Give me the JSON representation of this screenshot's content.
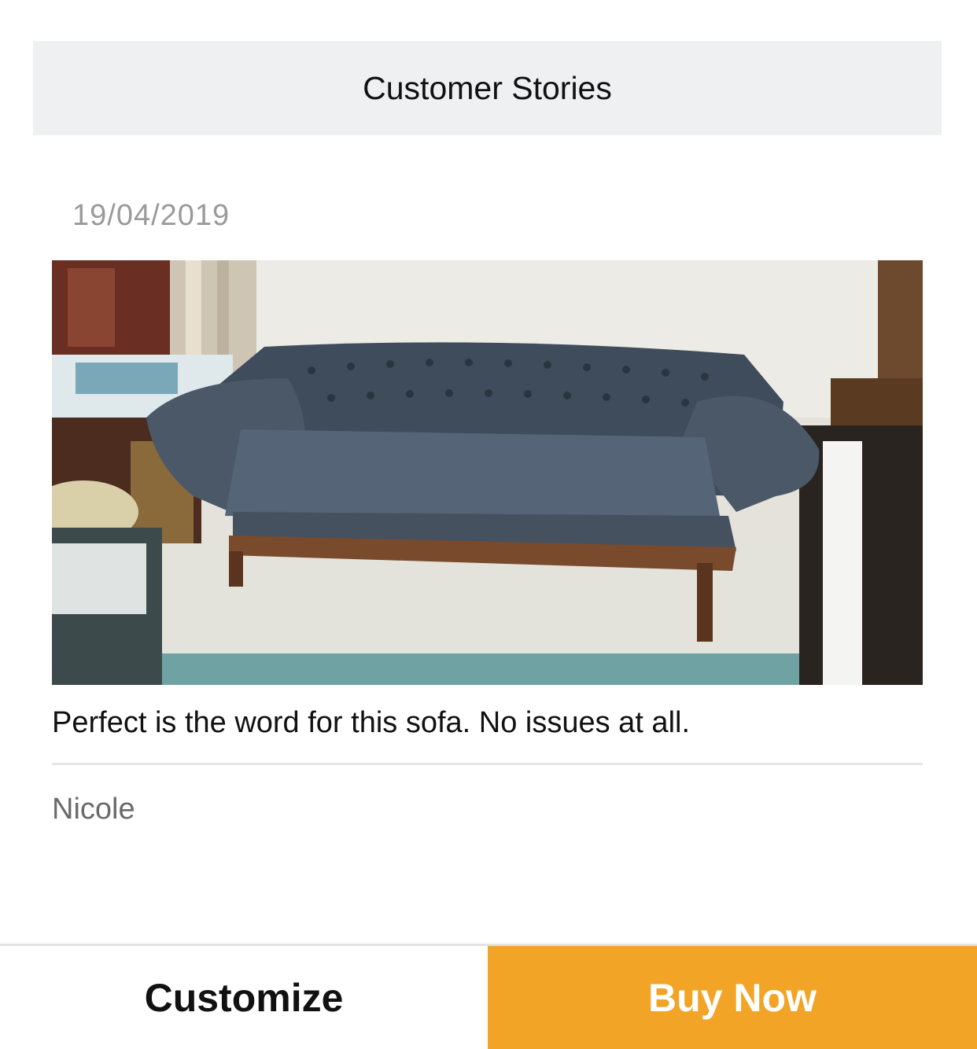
{
  "header": {
    "title": "Customer Stories"
  },
  "story": {
    "date": "19/04/2019",
    "photo_icon": "sofa-photo",
    "text": "Perfect is the word for this sofa. No issues at all.",
    "author": "Nicole"
  },
  "actions": {
    "customize_label": "Customize",
    "buy_label": "Buy Now",
    "buy_color": "#f2a427"
  }
}
